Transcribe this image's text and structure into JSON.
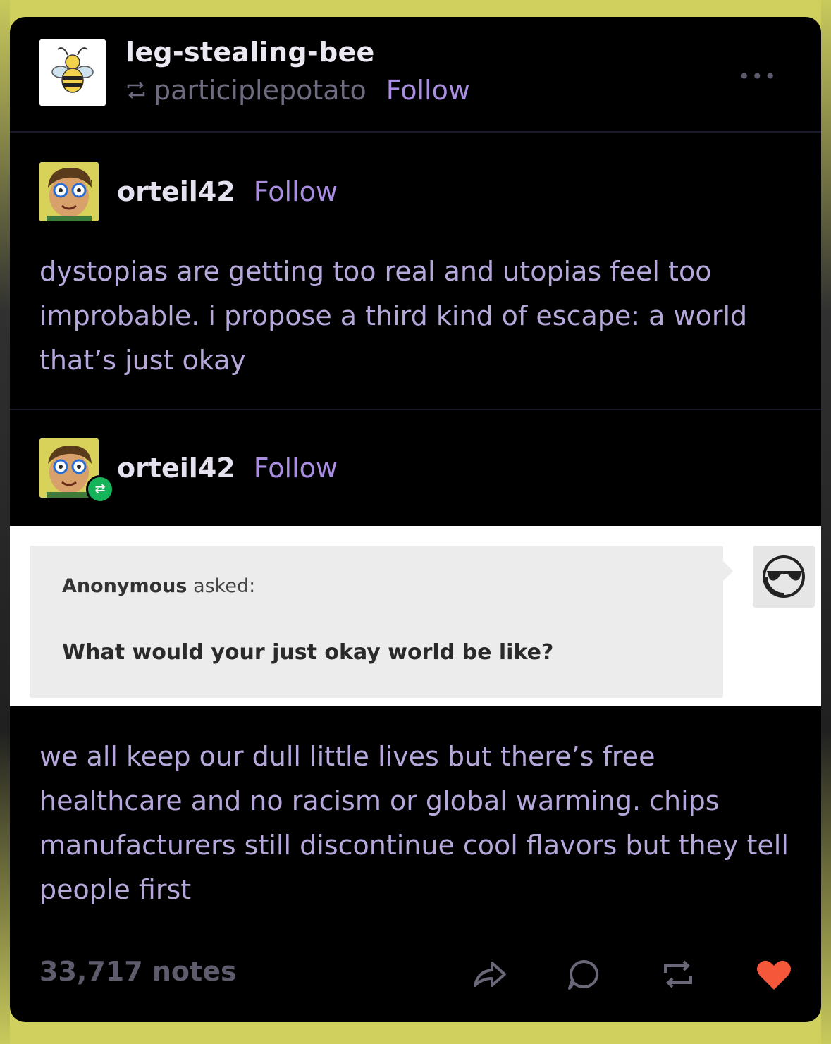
{
  "header": {
    "blog_name": "leg-stealing-bee",
    "reblogged_from": "participlepotato",
    "follow_label": "Follow",
    "more_label": "•••"
  },
  "original_post": {
    "username": "orteil42",
    "follow_label": "Follow",
    "text": "dystopias are getting too real and utopias feel too improbable. i propose a third kind of escape: a world that’s just okay"
  },
  "reblog_post": {
    "username": "orteil42",
    "follow_label": "Follow",
    "ask": {
      "asker": "Anonymous",
      "asked_label": "asked:",
      "question": "What would your just okay world be like?"
    },
    "answer": "we all keep our dull little lives but there’s free healthcare and no racism or global warming. chips manufacturers still discontinue cool flavors but they tell people first"
  },
  "footer": {
    "notes": "33,717 notes",
    "like_color": "#f5573b",
    "icons": [
      "share-icon",
      "reply-icon",
      "reblog-icon",
      "like-icon"
    ]
  },
  "colors": {
    "background": "#000000",
    "text": "#b6a8da",
    "link": "#a98ee2"
  }
}
